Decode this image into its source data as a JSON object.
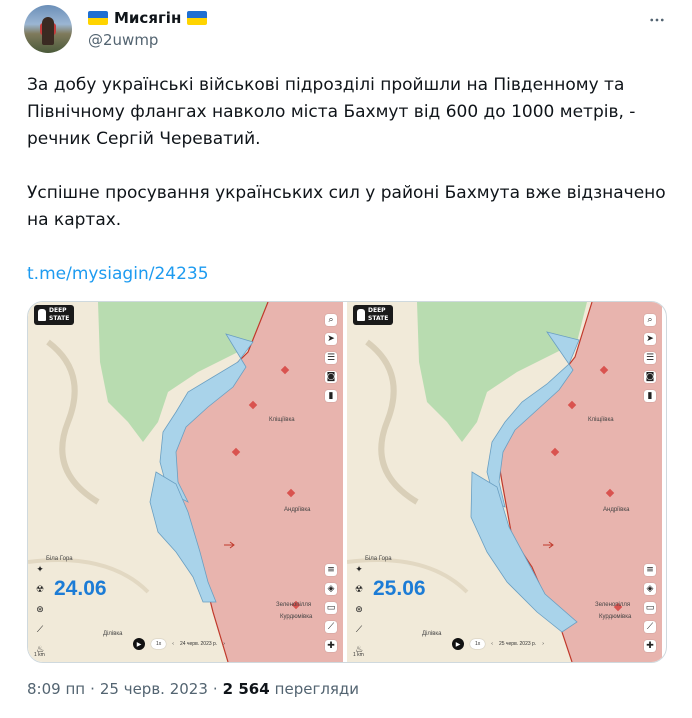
{
  "author": {
    "display_name": "Мисягін",
    "handle": "@2uwmp"
  },
  "tweet": {
    "paragraph1": "За добу українські військові підрозділі пройшли на Південному та Північному флангах навколо міста Бахмут від 600 до 1000 метрів, - речник Сергій Череватий.",
    "paragraph2": "Успішне просування українських сил у районі Бахмута вже відзначено на картах.",
    "link": "t.me/mysiagin/24235"
  },
  "media": {
    "logo_line1": "DEEP",
    "logo_line2": "STATE",
    "left": {
      "date_label": "24.06",
      "timebar_date": "24 черв. 2023 р."
    },
    "right": {
      "date_label": "25.06",
      "timebar_date": "25 черв. 2023 р."
    },
    "places": {
      "klishchiivka": "Кліщіївка",
      "andriivka": "Андріївка",
      "bila_hora": "Біла Гора",
      "zelenopillia": "Зеленопілля",
      "kurdiumivka": "Курдюмівка",
      "dylivka": "Ділівка"
    },
    "speed": "1x",
    "scale": "1 km"
  },
  "footer": {
    "time": "8:09 пп",
    "separator": "·",
    "date": "25 черв. 2023",
    "views_count": "2 564",
    "views_label": "перегляди"
  },
  "colors": {
    "link": "#1d9bf0",
    "russian_area": "#e8b4ae",
    "ukrainian_advance": "#a9d3ea",
    "green_area": "#b8dcb0",
    "map_background": "#f1ead9",
    "date_label": "#1c7cd6"
  },
  "icons": [
    "more-options-icon",
    "verified-flag-icon",
    "play-icon",
    "chess-knight-icon"
  ]
}
